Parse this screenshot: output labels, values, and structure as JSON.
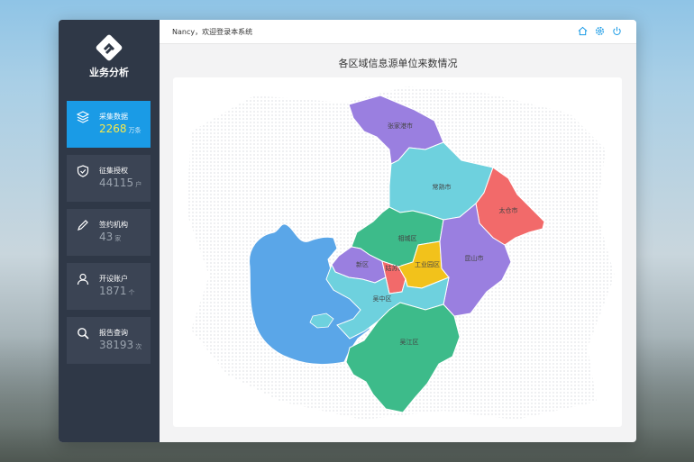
{
  "app": {
    "name": "业务分析"
  },
  "header": {
    "greeting": "Nancy，欢迎登录本系统"
  },
  "sidebar": {
    "items": [
      {
        "label": "采集数据",
        "value": "2268",
        "unit": "万条",
        "icon": "layers-icon",
        "active": true
      },
      {
        "label": "征集授权",
        "value": "44115",
        "unit": "户",
        "icon": "shield-check-icon",
        "active": false
      },
      {
        "label": "签约机构",
        "value": "43",
        "unit": "家",
        "icon": "pencil-icon",
        "active": false
      },
      {
        "label": "开设账户",
        "value": "1871",
        "unit": "个",
        "icon": "user-icon",
        "active": false
      },
      {
        "label": "报告查询",
        "value": "38193",
        "unit": "次",
        "icon": "search-icon",
        "active": false
      }
    ]
  },
  "main": {
    "title": "各区域信息源单位来数情况"
  },
  "map": {
    "regions": [
      {
        "name": "张家港市",
        "color": "#9a7fe0"
      },
      {
        "name": "常熟市",
        "color": "#6ed1de"
      },
      {
        "name": "太仓市",
        "color": "#f26a6a"
      },
      {
        "name": "相城区",
        "color": "#3dbb8a"
      },
      {
        "name": "新区",
        "color": "#9a7fe0"
      },
      {
        "name": "姑苏区",
        "color": "#f26a6a"
      },
      {
        "name": "工业园区",
        "color": "#f2c21b"
      },
      {
        "name": "昆山市",
        "color": "#9a7fe0"
      },
      {
        "name": "吴中区",
        "color": "#6ed1de"
      },
      {
        "name": "吴江区",
        "color": "#3dbb8a"
      }
    ],
    "lake_color": "#5aa6e8"
  },
  "colors": {
    "sidebar_bg": "#2f3847",
    "accent": "#1a9be6",
    "highlight_value": "#f7e94a"
  }
}
